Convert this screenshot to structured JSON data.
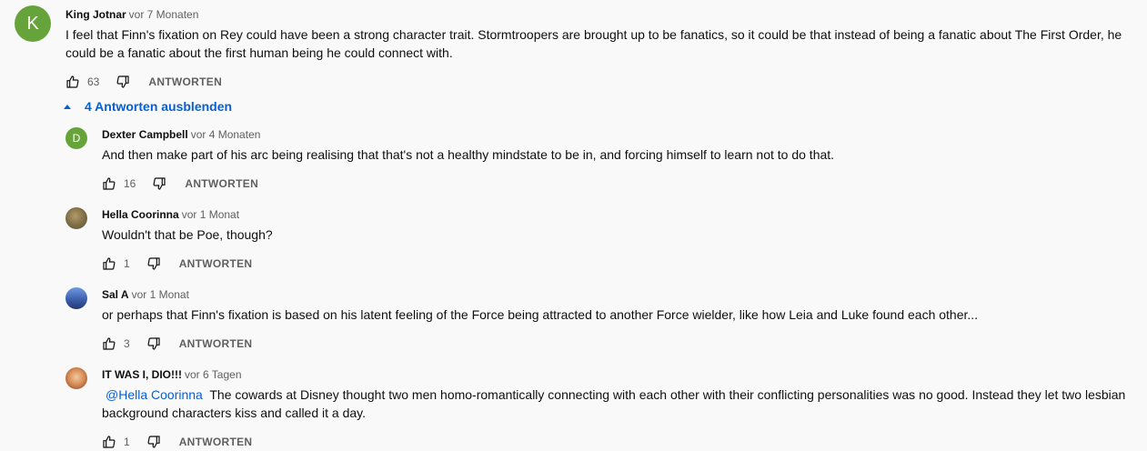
{
  "main_comment": {
    "avatar_letter": "K",
    "avatar_color": "#67a33b",
    "author": "King Jotnar",
    "time": "vor 7 Monaten",
    "text": "I feel that Finn's fixation on Rey could have been a strong character trait. Stormtroopers are brought up to be fanatics, so it could be that instead of being a fanatic about The First Order, he\ncould be a fanatic about the first human being he could connect with.",
    "likes": "63",
    "reply_label": "ANTWORTEN"
  },
  "replies_toggle": {
    "label": "4 Antworten ausblenden"
  },
  "replies": [
    {
      "avatar_letter": "D",
      "avatar_color": "#67a33b",
      "author": "Dexter Campbell",
      "time": "vor 4 Monaten",
      "text": "And then make part of his arc being realising that that's not a healthy mindstate to be in, and forcing himself to learn not to do that.",
      "likes": "16",
      "reply_label": "ANTWORTEN"
    },
    {
      "avatar_letter": "",
      "avatar_color": "#8a7a5a",
      "author": "Hella Coorinna",
      "time": "vor 1 Monat",
      "text": "Wouldn't that be Poe, though?",
      "likes": "1",
      "reply_label": "ANTWORTEN"
    },
    {
      "avatar_letter": "",
      "avatar_color": "#3a5aa8",
      "author": "Sal A",
      "time": "vor 1 Monat",
      "text": "or perhaps that Finn's fixation is based on his latent feeling of the Force being attracted to another Force wielder, like how Leia and Luke found each other...",
      "likes": "3",
      "reply_label": "ANTWORTEN"
    },
    {
      "avatar_letter": "",
      "avatar_color": "#c77a3a",
      "author": "IT WAS I, DIO!!!",
      "time": "vor 6 Tagen",
      "mention": "@Hella Coorinna",
      "text": "  The cowards at Disney thought two men homo-romantically connecting with each other with their conflicting personalities was no good. Instead they let two lesbian\nbackground characters kiss and called it a day.",
      "likes": "1",
      "reply_label": "ANTWORTEN"
    }
  ]
}
